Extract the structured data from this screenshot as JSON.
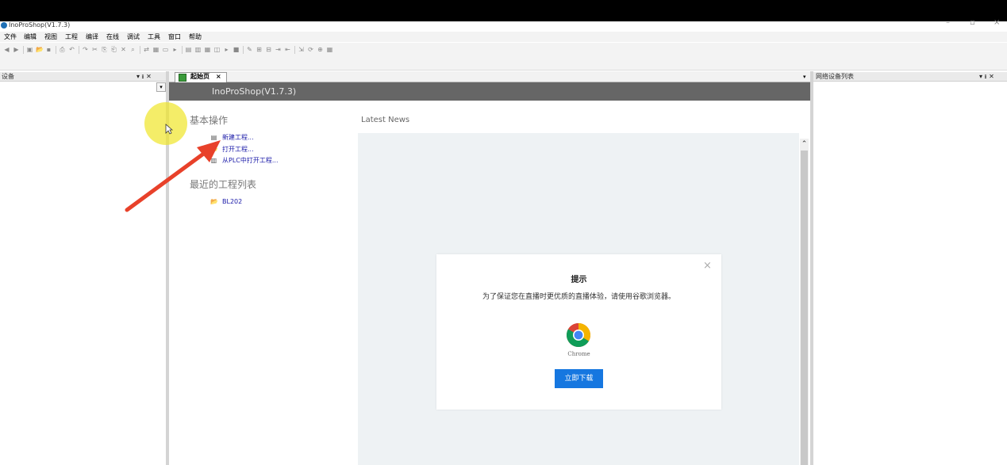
{
  "window": {
    "title": "InoProShop(V1.7.3)",
    "min_glyph": "–",
    "max_glyph": "▫",
    "close_glyph": "×"
  },
  "menu": [
    "文件",
    "编辑",
    "视图",
    "工程",
    "编译",
    "在线",
    "调试",
    "工具",
    "窗口",
    "帮助"
  ],
  "toolbar_glyphs": [
    "◀",
    "▶",
    "▣",
    "📂",
    "▪",
    "⎙",
    "↶",
    "↷",
    "✂",
    "⎘",
    "⎗",
    "✕",
    "⌕",
    "⇄",
    "▦",
    "▭",
    "▸",
    "▤",
    "▥",
    "▦",
    "◫",
    "▸",
    "■",
    "✎",
    "⊞",
    "⊟",
    "⇥",
    "⇤",
    "⇲",
    "⟳",
    "⊕",
    "▦"
  ],
  "left_panel": {
    "title": "设备",
    "pin": "▾ ᵻ ✕",
    "dropdown_glyph": "▾"
  },
  "right_panel": {
    "title": "网络设备列表",
    "pin": "▾ ᵻ ✕"
  },
  "tab": {
    "label": "起始页",
    "close": "×",
    "dropdown_glyph": "▾"
  },
  "start_page": {
    "banner": "InoProShop(V1.7.3)",
    "basic_ops_title": "基本操作",
    "links": [
      {
        "label": "新建工程...",
        "icon": "new-project-icon",
        "glyph": "▤"
      },
      {
        "label": "打开工程...",
        "icon": "open-project-icon",
        "glyph": "📂"
      },
      {
        "label": "从PLC中打开工程...",
        "icon": "plc-open-icon",
        "glyph": "▥"
      }
    ],
    "recent_title": "最近的工程列表",
    "recent": [
      {
        "label": "BL202",
        "icon": "folder-open-icon",
        "glyph": "📂"
      }
    ]
  },
  "news": {
    "title": "Latest News",
    "scroll_up_glyph": "⌃"
  },
  "modal": {
    "close": "×",
    "title": "提示",
    "message": "为了保证您在直播时更优质的直播体验，请使用谷歌浏览器。",
    "browser": "Chrome",
    "button": "立即下载"
  },
  "colors": {
    "accent": "#1677e0",
    "banner": "#666666",
    "link": "#1a1aa8",
    "highlight": "#f0e628",
    "arrow": "#e8412a"
  }
}
